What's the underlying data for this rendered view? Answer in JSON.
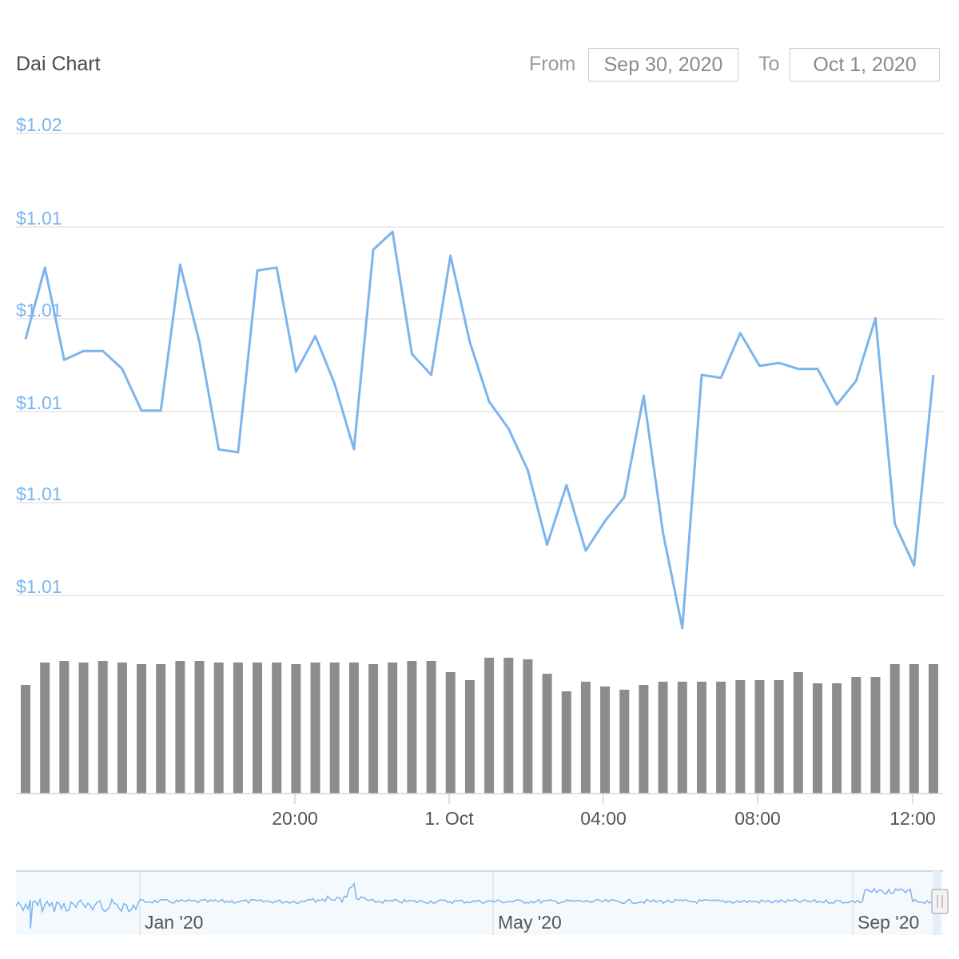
{
  "header": {
    "title": "Dai Chart",
    "from_label": "From",
    "from_value": "Sep 30, 2020",
    "to_label": "To",
    "to_value": "Oct 1, 2020"
  },
  "colors": {
    "line": "#7cb5ec",
    "volume": "#8c8c8c",
    "grid": "#e6e6e6",
    "navigator_fill": "#f4f9fd"
  },
  "chart_data": [
    {
      "type": "line",
      "title": "Dai Chart",
      "series": [
        {
          "values": [
            1.0131,
            1.0155,
            1.0124,
            1.0127,
            1.0127,
            1.0121,
            1.0107,
            1.0107,
            1.0156,
            1.013,
            1.0094,
            1.0093,
            1.0154,
            1.0155,
            1.012,
            1.0132,
            1.0116,
            1.0094,
            1.0161,
            1.0167,
            1.0126,
            1.0119,
            1.0159,
            1.013,
            1.011,
            1.0101,
            1.0087,
            1.0062,
            1.0082,
            1.006,
            1.007,
            1.0078,
            1.0112,
            1.0066,
            1.0034,
            1.0119,
            1.0118,
            1.0133,
            1.0122,
            1.0123,
            1.0121,
            1.0121,
            1.0109,
            1.0117,
            1.0138,
            1.0069,
            1.0055,
            1.0119
          ]
        }
      ],
      "y_tick_labels": [
        "$1.02",
        "$1.01",
        "$1.01",
        "$1.01",
        "$1.01",
        "$1.01"
      ],
      "ylim": [
        1.0045,
        1.02
      ]
    },
    {
      "type": "bar",
      "series": [
        {
          "values": [
            136,
            164,
            166,
            164,
            166,
            164,
            162,
            162,
            166,
            166,
            164,
            164,
            164,
            164,
            162,
            164,
            164,
            164,
            162,
            164,
            166,
            166,
            152,
            142,
            170,
            170,
            168,
            150,
            128,
            140,
            134,
            130,
            136,
            140,
            140,
            140,
            140,
            142,
            142,
            142,
            152,
            138,
            138,
            146,
            146,
            162,
            162,
            162
          ]
        }
      ],
      "x_tick_labels": [
        "20:00",
        "1. Oct",
        "04:00",
        "08:00",
        "12:00"
      ]
    },
    {
      "type": "area",
      "x_tick_labels": [
        "Jan '20",
        "May '20",
        "Sep '20"
      ]
    }
  ]
}
